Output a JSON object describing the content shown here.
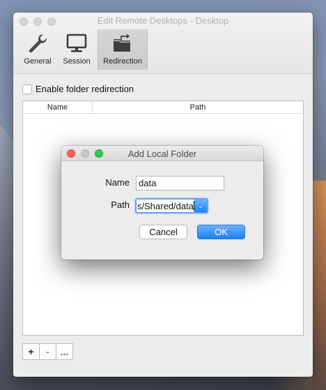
{
  "window": {
    "title": "Edit Remote Desktops - Desktop",
    "toolbar": [
      {
        "label": "General",
        "icon": "wrench-icon"
      },
      {
        "label": "Session",
        "icon": "monitor-icon"
      },
      {
        "label": "Redirection",
        "icon": "folder-redirect-icon"
      }
    ],
    "enable_folder_redirection_label": "Enable folder redirection",
    "table": {
      "columns": [
        "Name",
        "Path"
      ],
      "rows": []
    },
    "buttons": {
      "add": "+",
      "remove": "-",
      "more": "..."
    }
  },
  "dialog": {
    "title": "Add Local Folder",
    "name_label": "Name",
    "name_value": "data",
    "path_label": "Path",
    "path_value": "s/Shared/data",
    "cancel_label": "Cancel",
    "ok_label": "OK"
  }
}
